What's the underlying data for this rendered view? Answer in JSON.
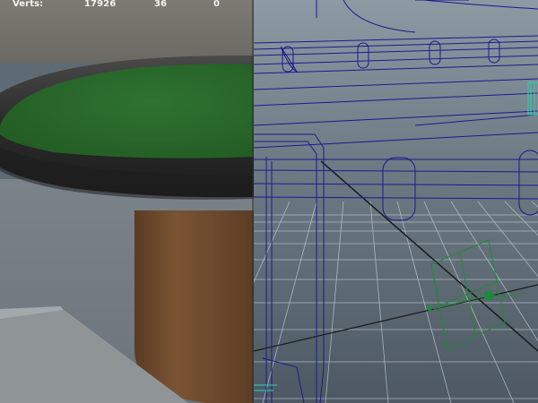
{
  "window": {
    "viewports": [
      "shaded-perspective",
      "wireframe-perspective"
    ]
  },
  "hud": {
    "label": "Verts:",
    "values": [
      "17926",
      "36",
      "0"
    ]
  },
  "colors": {
    "felt": "#2b6b2b",
    "rail": "#343434",
    "pedestal": "#6e4a2c",
    "wire_blue": "#1a1a8f",
    "wire_selected": "#2ed3b0",
    "grid_line": "#c7d1d8"
  },
  "icons": {
    "manipulator": "transform-gizmo-icon",
    "origin": "axis-origin-icon"
  }
}
